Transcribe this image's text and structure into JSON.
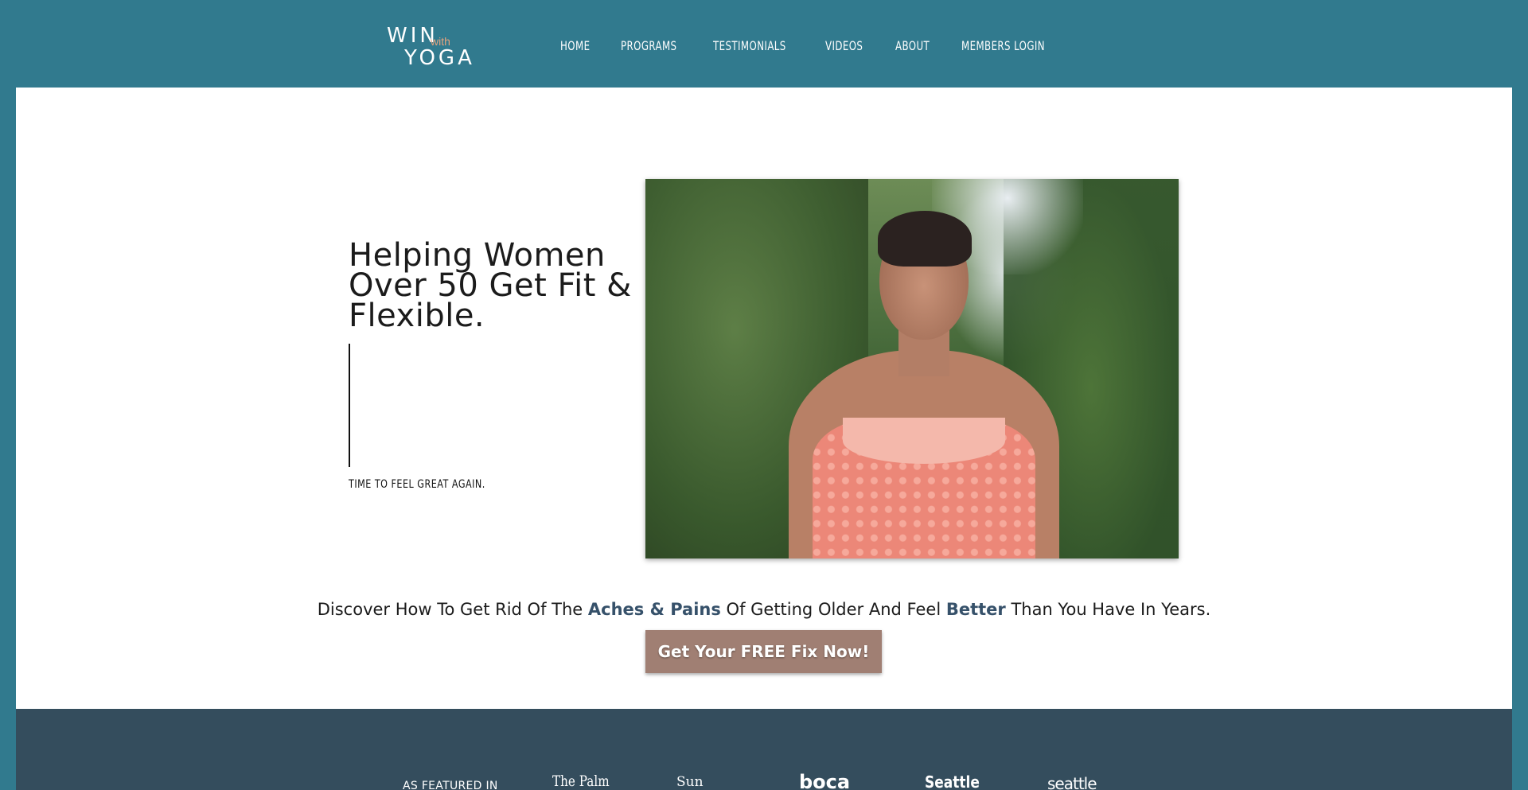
{
  "brand": {
    "line1": "WIN",
    "with": "with",
    "line2": "YOGA"
  },
  "nav": {
    "items": [
      "HOME",
      "PROGRAMS",
      "TESTIMONIALS",
      "VIDEOS",
      "ABOUT",
      "MEMBERS LOGIN"
    ]
  },
  "hero": {
    "title": "Helping Women Over 50 Get Fit & Flexible.",
    "tagline": "TIME TO FEEL GREAT AGAIN."
  },
  "discover": {
    "part1": "Discover How To Get Rid Of The ",
    "em1": "Aches & Pains",
    "part2": " Of Getting Older And Feel ",
    "em2": "Better",
    "part3": " Than You Have In Years."
  },
  "cta": {
    "label": "Get Your FREE Fix Now!"
  },
  "featured": {
    "label": "AS FEATURED IN",
    "publications": [
      "The Palm",
      "Sun",
      "boca",
      "Seattle",
      "seattle"
    ]
  },
  "colors": {
    "header_bg": "#317a8e",
    "featured_bg": "#344d5d",
    "cta_bg": "#a07f73",
    "accent_text": "#36516a",
    "logo_with": "#e4a37e"
  }
}
